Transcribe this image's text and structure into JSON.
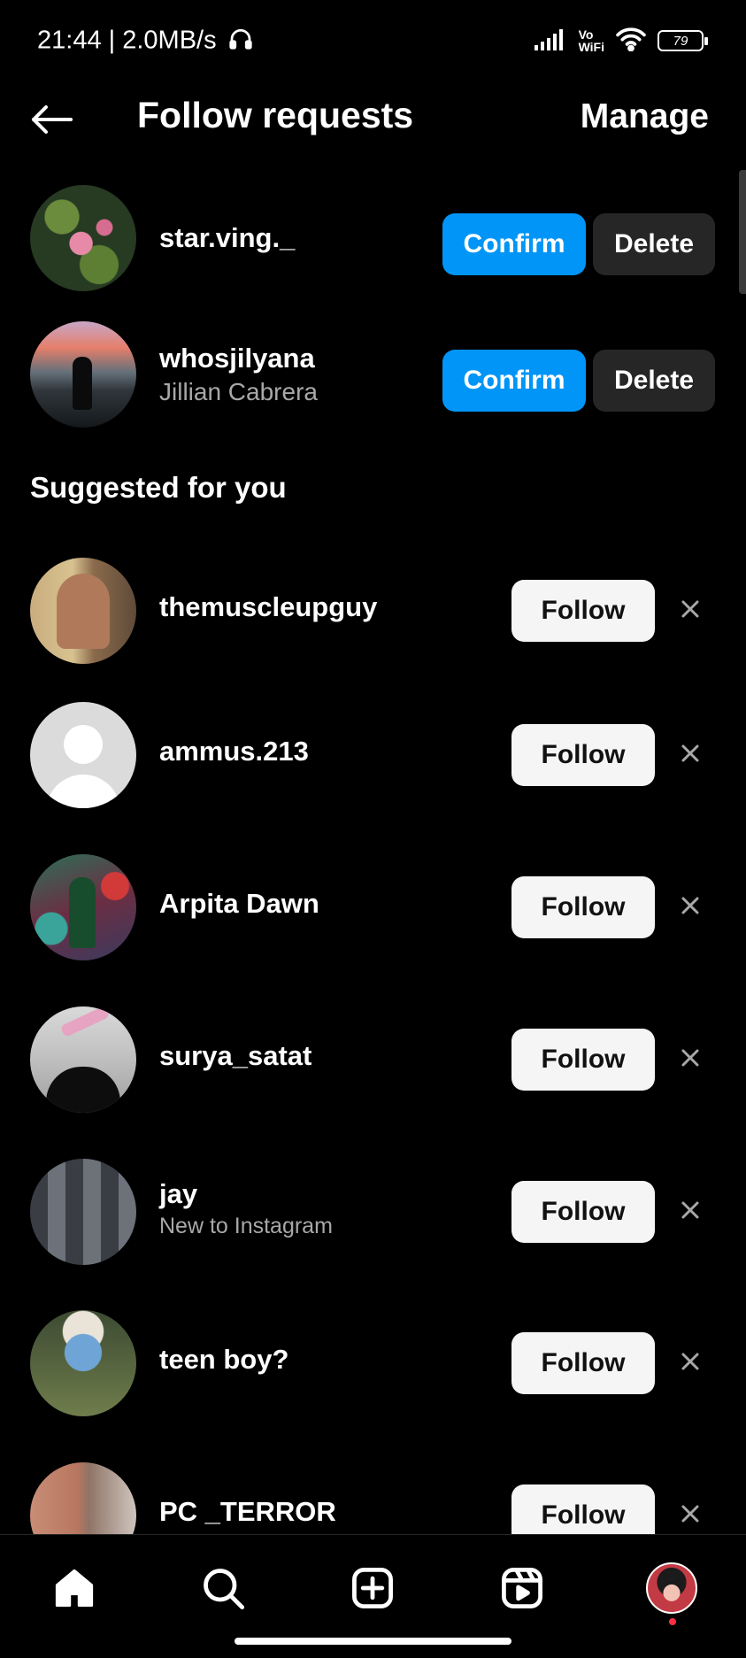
{
  "status_bar": {
    "time_speed": "21:44 | 2.0MB/s",
    "vowifi_top": "Vo",
    "vowifi_bottom": "WiFi",
    "battery": "79"
  },
  "header": {
    "title": "Follow requests",
    "manage_label": "Manage"
  },
  "requests": [
    {
      "username": "star.ving._",
      "subname": "",
      "confirm_label": "Confirm",
      "delete_label": "Delete"
    },
    {
      "username": "whosjilyana",
      "subname": "Jillian Cabrera",
      "confirm_label": "Confirm",
      "delete_label": "Delete"
    }
  ],
  "suggested_title": "Suggested for you",
  "suggestions": [
    {
      "username": "themuscleupguy",
      "subname": "",
      "follow_label": "Follow"
    },
    {
      "username": "ammus.213",
      "subname": "",
      "follow_label": "Follow"
    },
    {
      "username": "Arpita Dawn",
      "subname": "",
      "follow_label": "Follow"
    },
    {
      "username": "surya_satat",
      "subname": "",
      "follow_label": "Follow"
    },
    {
      "username": "jay",
      "subname": "New to Instagram",
      "follow_label": "Follow"
    },
    {
      "username": "teen boy?",
      "subname": "",
      "follow_label": "Follow"
    },
    {
      "username": "PC _TERROR",
      "subname": "",
      "follow_label": "Follow"
    }
  ],
  "nav": {
    "items": [
      "home-icon",
      "search-icon",
      "create-icon",
      "reels-icon",
      "profile-avatar"
    ],
    "active": "home-icon",
    "notification_dot_color": "#ff3040"
  },
  "colors": {
    "confirm": "#0095f6",
    "delete": "#262626",
    "follow": "#f5f5f5"
  }
}
